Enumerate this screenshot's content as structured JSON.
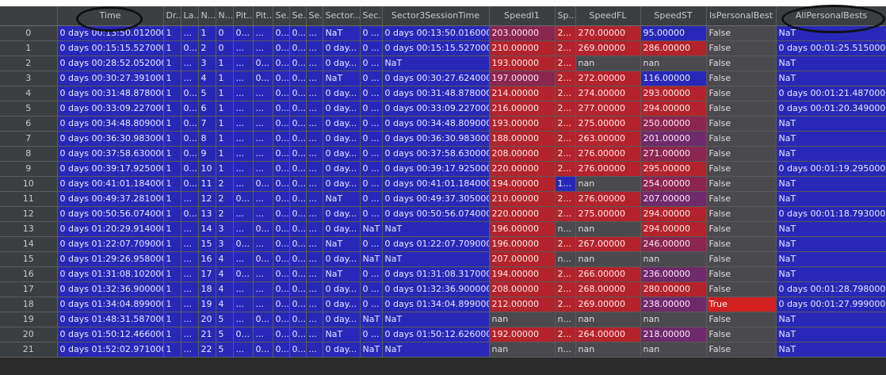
{
  "columns": [
    "",
    "Time",
    "Dr...",
    "La...",
    "N...",
    "N...",
    "Pit...",
    "Pit...",
    "Se...",
    "Se...",
    "Se...",
    "Sector...",
    "Sec...",
    "Sector3SessionTime",
    "SpeedI1",
    "Sp...",
    "SpeedFL",
    "SpeedST",
    "IsPersonalBest",
    "AllPersonalBests"
  ],
  "rows": [
    [
      "0",
      "0 days 00:13:50.012000",
      "1",
      "...",
      "1",
      "0",
      "0...",
      "...",
      "0...",
      "0...",
      "...",
      "NaT",
      "0 ...",
      "0 days 00:13:50.016000",
      "203.00000",
      "2...",
      "270.00000",
      "95.00000",
      "False",
      "NaT"
    ],
    [
      "1",
      "0 days 00:15:15.527000",
      "1",
      "0...",
      "2",
      "0",
      "...",
      "...",
      "0...",
      "0...",
      "...",
      "0 day...",
      "0 ...",
      "0 days 00:15:15.527000",
      "210.00000",
      "2...",
      "269.00000",
      "286.00000",
      "False",
      "0 days 00:01:25.515000"
    ],
    [
      "2",
      "0 days 00:28:52.052000",
      "1",
      "...",
      "3",
      "1",
      "...",
      "0...",
      "0...",
      "0...",
      "...",
      "0 day...",
      "0 ...",
      "NaT",
      "193.00000",
      "2...",
      "nan",
      "nan",
      "False",
      "NaT"
    ],
    [
      "3",
      "0 days 00:30:27.391000",
      "1",
      "...",
      "4",
      "1",
      "...",
      "0...",
      "0...",
      "0...",
      "...",
      "NaT",
      "0 ...",
      "0 days 00:30:27.624000",
      "197.00000",
      "2...",
      "272.00000",
      "116.00000",
      "False",
      "NaT"
    ],
    [
      "4",
      "0 days 00:31:48.878000",
      "1",
      "0...",
      "5",
      "1",
      "...",
      "...",
      "0...",
      "0...",
      "...",
      "0 day...",
      "0 ...",
      "0 days 00:31:48.878000",
      "214.00000",
      "2...",
      "274.00000",
      "293.00000",
      "False",
      "0 days 00:01:21.487000"
    ],
    [
      "5",
      "0 days 00:33:09.227000",
      "1",
      "0...",
      "6",
      "1",
      "...",
      "...",
      "0...",
      "0...",
      "...",
      "0 day...",
      "0 ...",
      "0 days 00:33:09.227000",
      "216.00000",
      "2...",
      "277.00000",
      "294.00000",
      "False",
      "0 days 00:01:20.349000"
    ],
    [
      "6",
      "0 days 00:34:48.809000",
      "1",
      "0...",
      "7",
      "1",
      "...",
      "...",
      "0...",
      "0...",
      "...",
      "0 day...",
      "0 ...",
      "0 days 00:34:48.809000",
      "193.00000",
      "2...",
      "275.00000",
      "250.00000",
      "False",
      "NaT"
    ],
    [
      "7",
      "0 days 00:36:30.983000",
      "1",
      "0...",
      "8",
      "1",
      "...",
      "...",
      "0...",
      "0...",
      "...",
      "0 day...",
      "0 ...",
      "0 days 00:36:30.983000",
      "188.00000",
      "2...",
      "263.00000",
      "201.00000",
      "False",
      "NaT"
    ],
    [
      "8",
      "0 days 00:37:58.630000",
      "1",
      "0...",
      "9",
      "1",
      "...",
      "...",
      "0...",
      "0...",
      "...",
      "0 day...",
      "0 ...",
      "0 days 00:37:58.630000",
      "208.00000",
      "2...",
      "276.00000",
      "271.00000",
      "False",
      "NaT"
    ],
    [
      "9",
      "0 days 00:39:17.925000",
      "1",
      "0...",
      "10",
      "1",
      "...",
      "...",
      "0...",
      "0...",
      "...",
      "0 day...",
      "0 ...",
      "0 days 00:39:17.925000",
      "220.00000",
      "2...",
      "276.00000",
      "295.00000",
      "False",
      "0 days 00:01:19.295000"
    ],
    [
      "10",
      "0 days 00:41:01.184000",
      "1",
      "0...",
      "11",
      "2",
      "...",
      "0...",
      "0...",
      "0...",
      "...",
      "0 day...",
      "0 ...",
      "0 days 00:41:01.184000",
      "194.00000",
      "1...",
      "nan",
      "254.00000",
      "False",
      "NaT"
    ],
    [
      "11",
      "0 days 00:49:37.281000",
      "1",
      "...",
      "12",
      "2",
      "0...",
      "...",
      "0...",
      "0...",
      "...",
      "NaT",
      "0 ...",
      "0 days 00:49:37.305000",
      "210.00000",
      "2...",
      "276.00000",
      "207.00000",
      "False",
      "NaT"
    ],
    [
      "12",
      "0 days 00:50:56.074000",
      "1",
      "0...",
      "13",
      "2",
      "...",
      "...",
      "0...",
      "0...",
      "...",
      "0 day...",
      "0 ...",
      "0 days 00:50:56.074000",
      "220.00000",
      "2...",
      "275.00000",
      "294.00000",
      "False",
      "0 days 00:01:18.793000"
    ],
    [
      "13",
      "0 days 01:20:29.914000",
      "1",
      "...",
      "14",
      "3",
      "...",
      "0...",
      "0...",
      "0...",
      "...",
      "0 day...",
      "NaT",
      "NaT",
      "196.00000",
      "n...",
      "nan",
      "294.00000",
      "False",
      "NaT"
    ],
    [
      "14",
      "0 days 01:22:07.709000",
      "1",
      "...",
      "15",
      "3",
      "0...",
      "...",
      "0...",
      "0...",
      "...",
      "NaT",
      "0 ...",
      "0 days 01:22:07.709000",
      "196.00000",
      "2...",
      "267.00000",
      "246.00000",
      "False",
      "NaT"
    ],
    [
      "15",
      "0 days 01:29:26.958000",
      "1",
      "...",
      "16",
      "4",
      "...",
      "0...",
      "0...",
      "0...",
      "...",
      "0 day...",
      "NaT",
      "NaT",
      "207.00000",
      "n...",
      "nan",
      "nan",
      "False",
      "NaT"
    ],
    [
      "16",
      "0 days 01:31:08.102000",
      "1",
      "...",
      "17",
      "4",
      "0...",
      "...",
      "0...",
      "0...",
      "...",
      "NaT",
      "0 ...",
      "0 days 01:31:08.317000",
      "194.00000",
      "2...",
      "266.00000",
      "236.00000",
      "False",
      "NaT"
    ],
    [
      "17",
      "0 days 01:32:36.900000",
      "1",
      "...",
      "18",
      "4",
      "...",
      "...",
      "0...",
      "0...",
      "...",
      "0 day...",
      "0 ...",
      "0 days 01:32:36.900000",
      "208.00000",
      "2...",
      "268.00000",
      "280.00000",
      "False",
      "0 days 00:01:28.798000"
    ],
    [
      "18",
      "0 days 01:34:04.899000",
      "1",
      "...",
      "19",
      "4",
      "...",
      "...",
      "0...",
      "0...",
      "...",
      "0 day...",
      "0 ...",
      "0 days 01:34:04.899000",
      "212.00000",
      "2...",
      "269.00000",
      "238.00000",
      "True",
      "0 days 00:01:27.999000"
    ],
    [
      "19",
      "0 days 01:48:31.587000",
      "1",
      "...",
      "20",
      "5",
      "...",
      "0...",
      "0...",
      "0...",
      "...",
      "0 day...",
      "NaT",
      "NaT",
      "nan",
      "n...",
      "nan",
      "nan",
      "False",
      "NaT"
    ],
    [
      "20",
      "0 days 01:50:12.466000",
      "1",
      "...",
      "21",
      "5",
      "0...",
      "...",
      "0...",
      "0...",
      "...",
      "NaT",
      "0 ...",
      "0 days 01:50:12.626000",
      "192.00000",
      "2...",
      "264.00000",
      "218.00000",
      "False",
      "NaT"
    ],
    [
      "21",
      "0 days 01:52:02.971000",
      "1",
      "...",
      "22",
      "5",
      "...",
      "0...",
      "0...",
      "0...",
      "...",
      "0 day...",
      "NaT",
      "NaT",
      "nan",
      "n...",
      "nan",
      "nan",
      "False",
      "NaT"
    ]
  ],
  "colors": {
    "blue": "#2828b8",
    "gray": "#4a4a4e",
    "red": "#b3232c",
    "purple": "#6e2a6a",
    "true_red": "#cf1f1f"
  }
}
